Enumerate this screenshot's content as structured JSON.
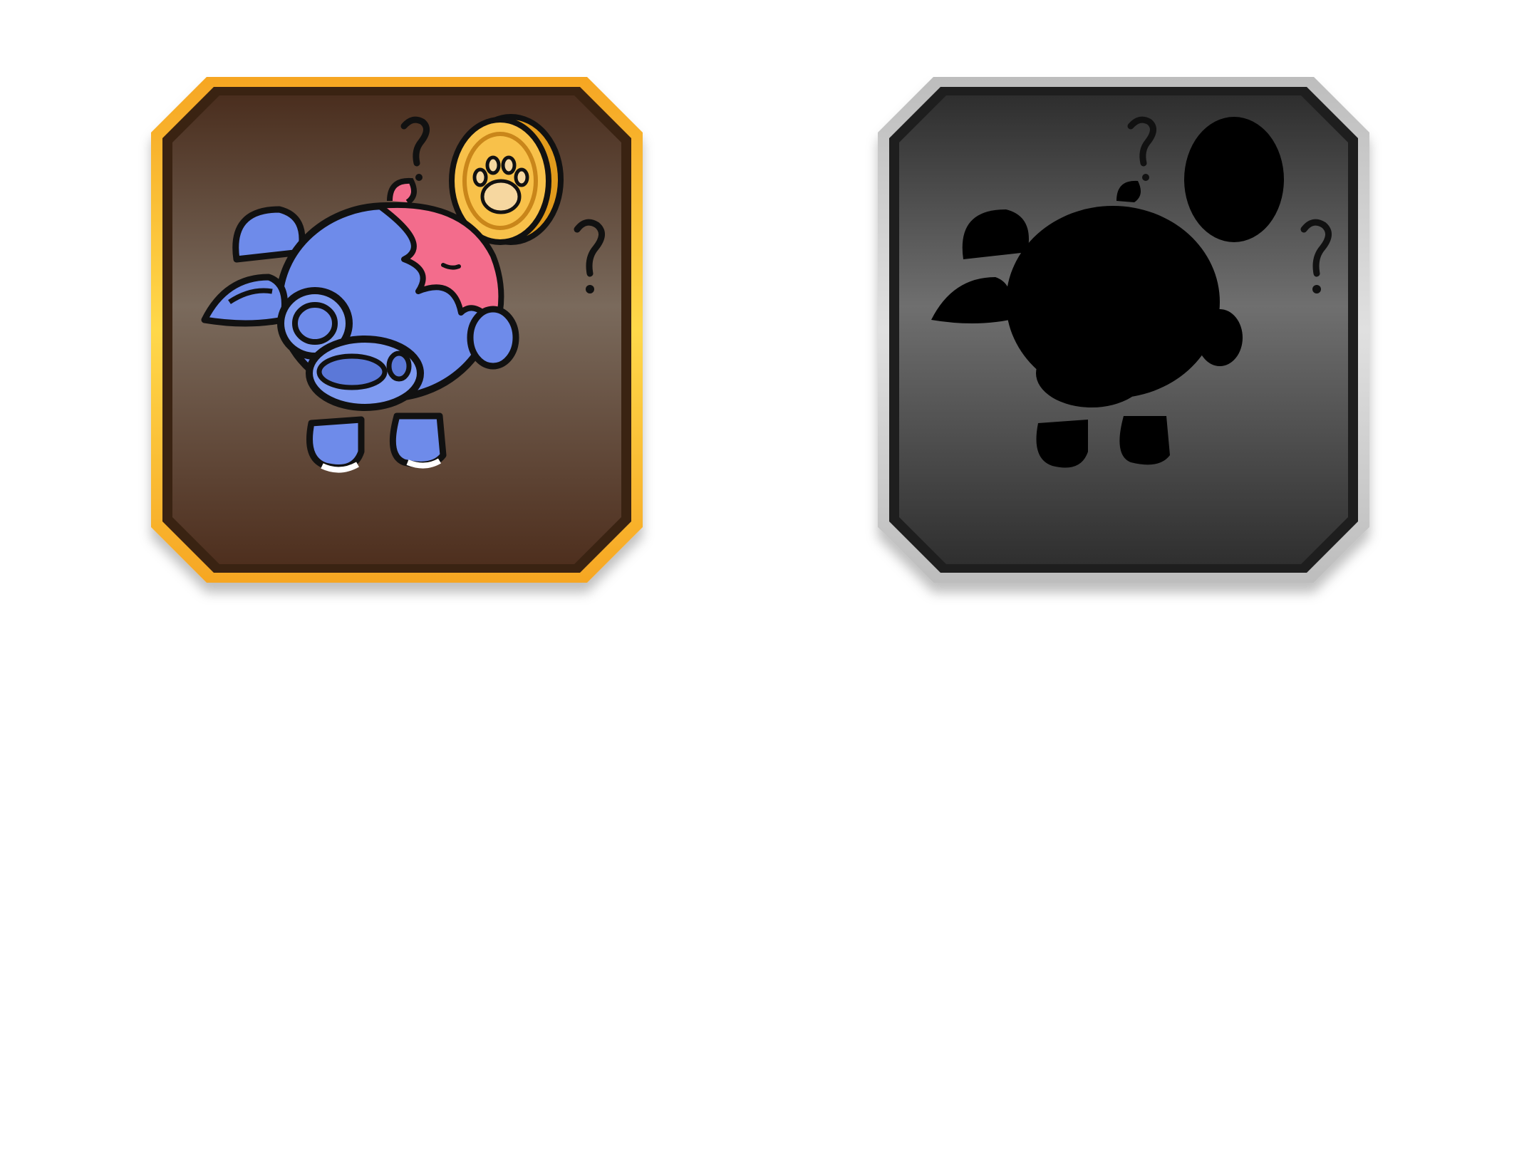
{
  "badges": [
    {
      "id": "piggy-coin",
      "state": "unlocked",
      "frame_color": "#F7B52C",
      "inner_color": "#5A3A26",
      "character_color": "#6E8BEA",
      "accent_color": "#F36C8C",
      "coin_color": "#F8C14A",
      "icons": [
        "blue-pig-icon",
        "paw-coin-icon",
        "question-mark-icon"
      ]
    },
    {
      "id": "piggy-coin-silhouette",
      "state": "locked",
      "frame_color": "#C8C8C8",
      "inner_color": "#4A4A4A",
      "character_color": "#000000",
      "icons": [
        "pig-silhouette-icon",
        "coin-silhouette-icon",
        "question-mark-icon"
      ]
    }
  ]
}
